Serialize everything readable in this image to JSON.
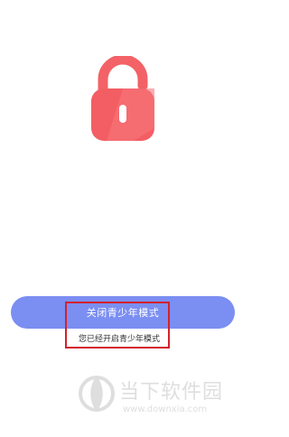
{
  "lock": {
    "icon": "unlocked-padlock-icon",
    "color": "#f26266"
  },
  "button": {
    "label": "关闭青少年模式",
    "color": "#7b8ef2"
  },
  "status": {
    "text": "您已经开启青少年模式"
  },
  "highlight": {
    "color": "#d3222a"
  },
  "watermark": {
    "title": "当下软件园",
    "url": "www.downxia.com",
    "icon": "downxia-logo-icon"
  }
}
